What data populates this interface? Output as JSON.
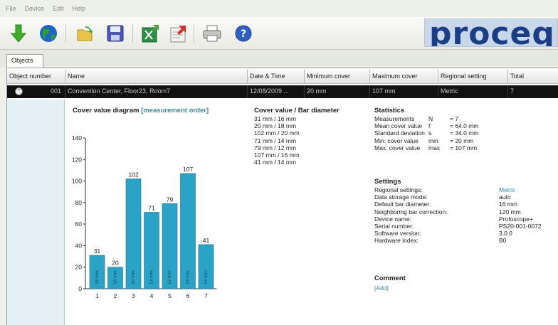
{
  "menu": [
    "File",
    "Device",
    "Edit",
    "Help"
  ],
  "toolbar": {
    "buttons": [
      "download-icon",
      "globe-icon",
      "open-folder-icon",
      "save-icon",
      "export-excel-icon",
      "export-pdf-icon",
      "print-icon",
      "help-icon"
    ]
  },
  "brand": {
    "logo_text": "proceq",
    "color": "#1a3d85"
  },
  "tabs": [
    {
      "label": "Objects"
    }
  ],
  "table": {
    "headers": [
      "Object number",
      "Name",
      "Date & Time",
      "Minimum cover",
      "Maximum cover",
      "Regional setting",
      "Total"
    ],
    "rows": [
      {
        "number": "001",
        "name": "Convention Center, Floor23, Room7",
        "datetime": "12/08/2009 ...",
        "min_cover": "20 mm",
        "max_cover": "107 mm",
        "regional": "Metric",
        "total": "7"
      }
    ]
  },
  "chart": {
    "title": "Cover value diagram",
    "mode": "[measurement order]",
    "bar_color": "#2aa3c6"
  },
  "chart_data": {
    "type": "bar",
    "categories": [
      "1",
      "2",
      "3",
      "4",
      "5",
      "6",
      "7"
    ],
    "values": [
      31,
      20,
      102,
      71,
      79,
      107,
      41
    ],
    "bar_labels": [
      "16 mm",
      "18 mm",
      "20 mm",
      "14 mm",
      "12 mm",
      "16 mm",
      "14 mm"
    ],
    "yticks": [
      "0",
      "20",
      "40",
      "60",
      "80",
      "100",
      "120",
      "140"
    ],
    "ylim": [
      0,
      140
    ],
    "title": "Cover value diagram [measurement order]"
  },
  "cover_list": {
    "title": "Cover value / Bar diameter",
    "items": [
      "31 mm / 16 mm",
      "20 mm / 18 mm",
      "102 mm / 20 mm",
      "71 mm / 14 mm",
      "79 mm / 12 mm",
      "107 mm / 16 mm",
      "41 mm / 14 mm"
    ]
  },
  "statistics": {
    "title": "Statistics",
    "rows": [
      {
        "label": "Measurements",
        "sym": "N",
        "value": "= 7"
      },
      {
        "label": "Mean cover value",
        "sym": "f",
        "value": "= 64.0 mm"
      },
      {
        "label": "Standard deviation",
        "sym": "s",
        "value": "= 34.0 mm"
      },
      {
        "label": "Min. cover value",
        "sym": "min",
        "value": "= 20 mm"
      },
      {
        "label": "Max. cover value",
        "sym": "max",
        "value": "= 107 mm"
      }
    ]
  },
  "settings": {
    "title": "Settings",
    "rows": [
      {
        "label": "Regional settings:",
        "value": "Metric"
      },
      {
        "label": "Data storage mode:",
        "value": "auto"
      },
      {
        "label": "Default bar diameter:",
        "value": "16 mm"
      },
      {
        "label": "Neighboring bar correction:",
        "value": "120 mm"
      },
      {
        "label": "Device name:",
        "value": "Profoscope+"
      },
      {
        "label": "Serial number:",
        "value": "PS20-001-0072"
      },
      {
        "label": "Software version:",
        "value": "3.0.0"
      },
      {
        "label": "Hardware index:",
        "value": "B0"
      }
    ]
  },
  "comment": {
    "title": "Comment",
    "add_label": "[Add]"
  }
}
